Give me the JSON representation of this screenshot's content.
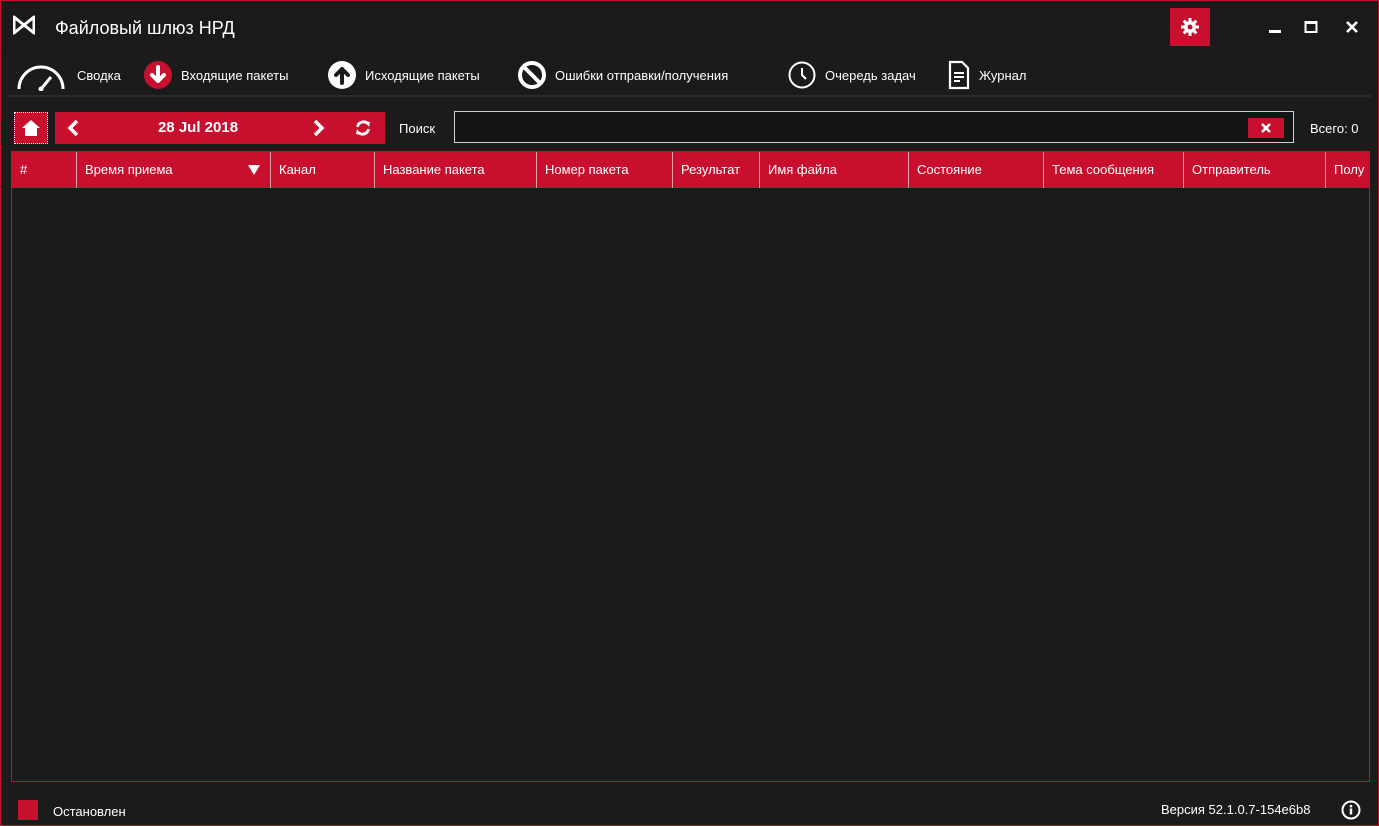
{
  "window": {
    "title": "Файловый шлюз НРД"
  },
  "nav": {
    "tabs": [
      {
        "label": "Сводка",
        "icon": "gauge-icon"
      },
      {
        "label": "Входящие пакеты",
        "icon": "arrow-down-circle-icon",
        "active": true
      },
      {
        "label": "Исходящие пакеты",
        "icon": "arrow-up-circle-icon"
      },
      {
        "label": "Ошибки отправки/получения",
        "icon": "ban-icon"
      },
      {
        "label": "Очередь задач",
        "icon": "clock-icon"
      },
      {
        "label": "Журнал",
        "icon": "document-icon"
      }
    ]
  },
  "toolbar": {
    "date": "28 Jul 2018",
    "search_label": "Поиск",
    "search_value": "",
    "total": "Всего: 0"
  },
  "table": {
    "columns": [
      "#",
      "Время приема",
      "Канал",
      "Название пакета",
      "Номер пакета",
      "Результат",
      "Имя файла",
      "Состояние",
      "Тема сообщения",
      "Отправитель",
      "Полу"
    ],
    "rows": []
  },
  "status": {
    "state": "Остановлен",
    "version": "Версия 52.1.0.7-154e6b8"
  },
  "colors": {
    "accent": "#c8102e",
    "background": "#1b1b1b"
  }
}
